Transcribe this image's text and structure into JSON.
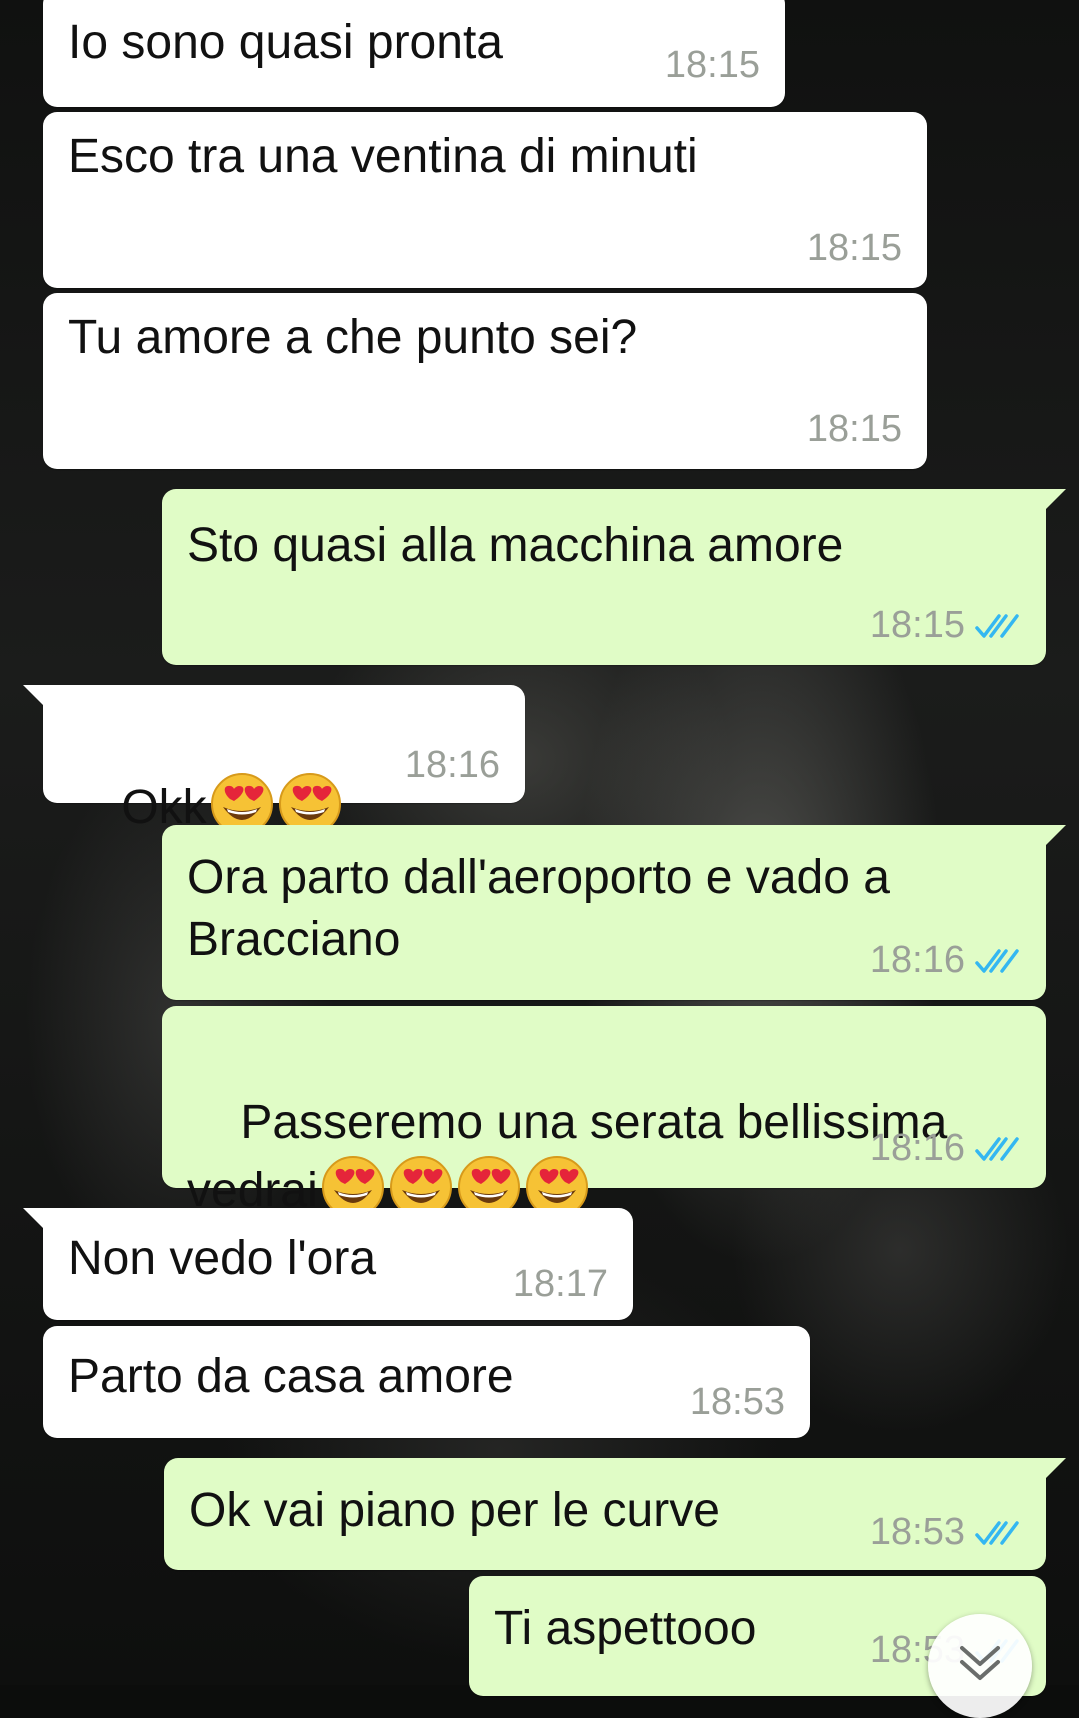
{
  "chat": {
    "messages": [
      {
        "direction": "incoming",
        "text": "Io sono quasi pronta",
        "time": "18:15"
      },
      {
        "direction": "incoming",
        "text": "Esco tra una ventina di minuti",
        "time": "18:15"
      },
      {
        "direction": "incoming",
        "text": "Tu amore a che punto sei?",
        "time": "18:15"
      },
      {
        "direction": "outgoing",
        "text": "Sto quasi alla macchina amore",
        "time": "18:15",
        "status": "read"
      },
      {
        "direction": "incoming",
        "text": "Okk",
        "emoji_count": 2,
        "emoji": "heart-eyes",
        "time": "18:16"
      },
      {
        "direction": "outgoing",
        "text": "Ora parto dall'aeroporto e vado a Bracciano",
        "time": "18:16",
        "status": "read"
      },
      {
        "direction": "outgoing",
        "text": "Passeremo una serata bellissima vedrai",
        "emoji_count": 4,
        "emoji": "heart-eyes",
        "time": "18:16",
        "status": "read"
      },
      {
        "direction": "incoming",
        "text": "Non vedo l'ora",
        "time": "18:17"
      },
      {
        "direction": "incoming",
        "text": "Parto da casa amore",
        "time": "18:53"
      },
      {
        "direction": "outgoing",
        "text": "Ok vai piano per le curve",
        "time": "18:53",
        "status": "read"
      },
      {
        "direction": "outgoing",
        "text": "Ti aspettooo",
        "time": "18:53",
        "status": "read"
      }
    ]
  },
  "colors": {
    "incoming_bubble": "#ffffff",
    "outgoing_bubble": "#e0fcc6",
    "timestamp": "#9a9f98",
    "read_ticks": "#34b7f1"
  },
  "icons": {
    "read_receipt": "double-check-icon",
    "emoji": "heart-eyes-emoji",
    "scroll_button": "chevron-double-down-icon"
  }
}
